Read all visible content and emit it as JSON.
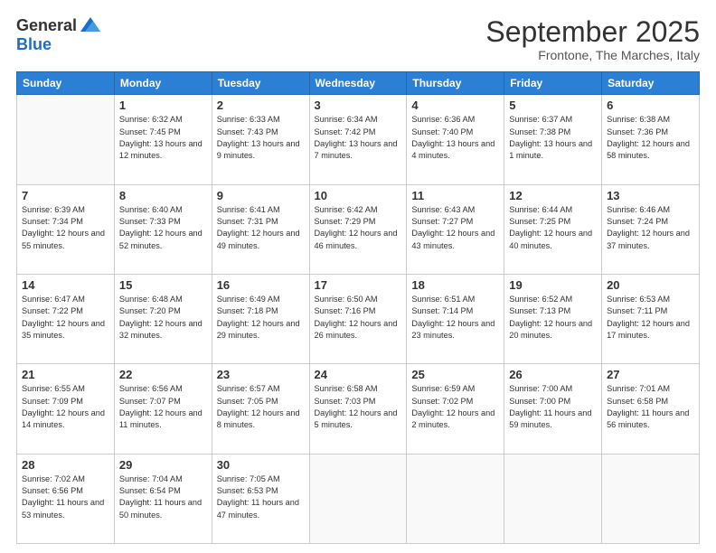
{
  "logo": {
    "general": "General",
    "blue": "Blue"
  },
  "header": {
    "month": "September 2025",
    "location": "Frontone, The Marches, Italy"
  },
  "weekdays": [
    "Sunday",
    "Monday",
    "Tuesday",
    "Wednesday",
    "Thursday",
    "Friday",
    "Saturday"
  ],
  "weeks": [
    [
      {
        "day": "",
        "sunrise": "",
        "sunset": "",
        "daylight": ""
      },
      {
        "day": "1",
        "sunrise": "Sunrise: 6:32 AM",
        "sunset": "Sunset: 7:45 PM",
        "daylight": "Daylight: 13 hours and 12 minutes."
      },
      {
        "day": "2",
        "sunrise": "Sunrise: 6:33 AM",
        "sunset": "Sunset: 7:43 PM",
        "daylight": "Daylight: 13 hours and 9 minutes."
      },
      {
        "day": "3",
        "sunrise": "Sunrise: 6:34 AM",
        "sunset": "Sunset: 7:42 PM",
        "daylight": "Daylight: 13 hours and 7 minutes."
      },
      {
        "day": "4",
        "sunrise": "Sunrise: 6:36 AM",
        "sunset": "Sunset: 7:40 PM",
        "daylight": "Daylight: 13 hours and 4 minutes."
      },
      {
        "day": "5",
        "sunrise": "Sunrise: 6:37 AM",
        "sunset": "Sunset: 7:38 PM",
        "daylight": "Daylight: 13 hours and 1 minute."
      },
      {
        "day": "6",
        "sunrise": "Sunrise: 6:38 AM",
        "sunset": "Sunset: 7:36 PM",
        "daylight": "Daylight: 12 hours and 58 minutes."
      }
    ],
    [
      {
        "day": "7",
        "sunrise": "Sunrise: 6:39 AM",
        "sunset": "Sunset: 7:34 PM",
        "daylight": "Daylight: 12 hours and 55 minutes."
      },
      {
        "day": "8",
        "sunrise": "Sunrise: 6:40 AM",
        "sunset": "Sunset: 7:33 PM",
        "daylight": "Daylight: 12 hours and 52 minutes."
      },
      {
        "day": "9",
        "sunrise": "Sunrise: 6:41 AM",
        "sunset": "Sunset: 7:31 PM",
        "daylight": "Daylight: 12 hours and 49 minutes."
      },
      {
        "day": "10",
        "sunrise": "Sunrise: 6:42 AM",
        "sunset": "Sunset: 7:29 PM",
        "daylight": "Daylight: 12 hours and 46 minutes."
      },
      {
        "day": "11",
        "sunrise": "Sunrise: 6:43 AM",
        "sunset": "Sunset: 7:27 PM",
        "daylight": "Daylight: 12 hours and 43 minutes."
      },
      {
        "day": "12",
        "sunrise": "Sunrise: 6:44 AM",
        "sunset": "Sunset: 7:25 PM",
        "daylight": "Daylight: 12 hours and 40 minutes."
      },
      {
        "day": "13",
        "sunrise": "Sunrise: 6:46 AM",
        "sunset": "Sunset: 7:24 PM",
        "daylight": "Daylight: 12 hours and 37 minutes."
      }
    ],
    [
      {
        "day": "14",
        "sunrise": "Sunrise: 6:47 AM",
        "sunset": "Sunset: 7:22 PM",
        "daylight": "Daylight: 12 hours and 35 minutes."
      },
      {
        "day": "15",
        "sunrise": "Sunrise: 6:48 AM",
        "sunset": "Sunset: 7:20 PM",
        "daylight": "Daylight: 12 hours and 32 minutes."
      },
      {
        "day": "16",
        "sunrise": "Sunrise: 6:49 AM",
        "sunset": "Sunset: 7:18 PM",
        "daylight": "Daylight: 12 hours and 29 minutes."
      },
      {
        "day": "17",
        "sunrise": "Sunrise: 6:50 AM",
        "sunset": "Sunset: 7:16 PM",
        "daylight": "Daylight: 12 hours and 26 minutes."
      },
      {
        "day": "18",
        "sunrise": "Sunrise: 6:51 AM",
        "sunset": "Sunset: 7:14 PM",
        "daylight": "Daylight: 12 hours and 23 minutes."
      },
      {
        "day": "19",
        "sunrise": "Sunrise: 6:52 AM",
        "sunset": "Sunset: 7:13 PM",
        "daylight": "Daylight: 12 hours and 20 minutes."
      },
      {
        "day": "20",
        "sunrise": "Sunrise: 6:53 AM",
        "sunset": "Sunset: 7:11 PM",
        "daylight": "Daylight: 12 hours and 17 minutes."
      }
    ],
    [
      {
        "day": "21",
        "sunrise": "Sunrise: 6:55 AM",
        "sunset": "Sunset: 7:09 PM",
        "daylight": "Daylight: 12 hours and 14 minutes."
      },
      {
        "day": "22",
        "sunrise": "Sunrise: 6:56 AM",
        "sunset": "Sunset: 7:07 PM",
        "daylight": "Daylight: 12 hours and 11 minutes."
      },
      {
        "day": "23",
        "sunrise": "Sunrise: 6:57 AM",
        "sunset": "Sunset: 7:05 PM",
        "daylight": "Daylight: 12 hours and 8 minutes."
      },
      {
        "day": "24",
        "sunrise": "Sunrise: 6:58 AM",
        "sunset": "Sunset: 7:03 PM",
        "daylight": "Daylight: 12 hours and 5 minutes."
      },
      {
        "day": "25",
        "sunrise": "Sunrise: 6:59 AM",
        "sunset": "Sunset: 7:02 PM",
        "daylight": "Daylight: 12 hours and 2 minutes."
      },
      {
        "day": "26",
        "sunrise": "Sunrise: 7:00 AM",
        "sunset": "Sunset: 7:00 PM",
        "daylight": "Daylight: 11 hours and 59 minutes."
      },
      {
        "day": "27",
        "sunrise": "Sunrise: 7:01 AM",
        "sunset": "Sunset: 6:58 PM",
        "daylight": "Daylight: 11 hours and 56 minutes."
      }
    ],
    [
      {
        "day": "28",
        "sunrise": "Sunrise: 7:02 AM",
        "sunset": "Sunset: 6:56 PM",
        "daylight": "Daylight: 11 hours and 53 minutes."
      },
      {
        "day": "29",
        "sunrise": "Sunrise: 7:04 AM",
        "sunset": "Sunset: 6:54 PM",
        "daylight": "Daylight: 11 hours and 50 minutes."
      },
      {
        "day": "30",
        "sunrise": "Sunrise: 7:05 AM",
        "sunset": "Sunset: 6:53 PM",
        "daylight": "Daylight: 11 hours and 47 minutes."
      },
      {
        "day": "",
        "sunrise": "",
        "sunset": "",
        "daylight": ""
      },
      {
        "day": "",
        "sunrise": "",
        "sunset": "",
        "daylight": ""
      },
      {
        "day": "",
        "sunrise": "",
        "sunset": "",
        "daylight": ""
      },
      {
        "day": "",
        "sunrise": "",
        "sunset": "",
        "daylight": ""
      }
    ]
  ]
}
